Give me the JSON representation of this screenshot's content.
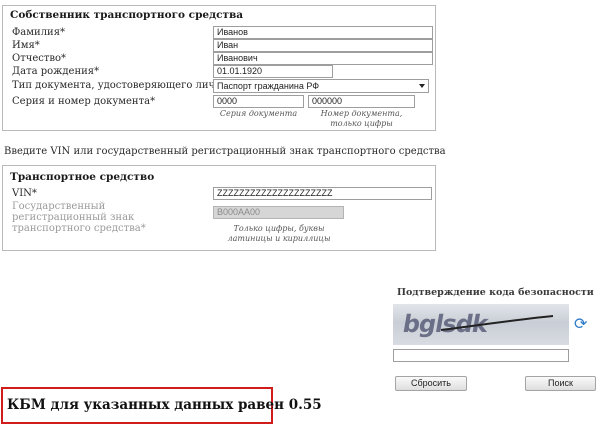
{
  "owner": {
    "title": "Собственник транспортного средства",
    "fields": {
      "surname": {
        "label": "Фамилия*",
        "value": "Иванов"
      },
      "name": {
        "label": "Имя*",
        "value": "Иван"
      },
      "patronymic": {
        "label": "Отчество*",
        "value": "Иванович"
      },
      "birth_date": {
        "label": "Дата рождения*",
        "value": "01.01.1920"
      },
      "doc_type": {
        "label": "Тип документа, удостоверяющего личность",
        "value": "Паспорт гражданина РФ"
      },
      "doc_number": {
        "label": "Серия и номер документа*",
        "series_value": "0000",
        "number_value": "000000",
        "series_hint": "Серия документа",
        "number_hint": "Номер документа, только цифры"
      }
    }
  },
  "vehicle_intro": "Введите VIN или государственный регистрационный знак транспортного средства",
  "vehicle": {
    "title": "Транспортное средство",
    "vin": {
      "label": "VIN*",
      "value": "ZZZZZZZZZZZZZZZZZZZZZ"
    },
    "reg_plate": {
      "label": "Государственный регистрационный знак транспортного средства*",
      "value": "В000АА00"
    },
    "reg_hint": "Только цифры, буквы латиницы и кириллицы"
  },
  "captcha": {
    "title": "Подтверждение кода безопасности",
    "image_text": "bglsdk",
    "input_value": ""
  },
  "buttons": {
    "reset": "Сбросить",
    "search": "Поиск"
  },
  "result": "КБМ для указанных данных равен 0.55",
  "colors": {
    "result_border": "#d11c1c",
    "refresh_icon": "#2e7bc8"
  },
  "icons": {
    "refresh": "refresh-icon",
    "dropdown": "chevron-down-icon"
  }
}
